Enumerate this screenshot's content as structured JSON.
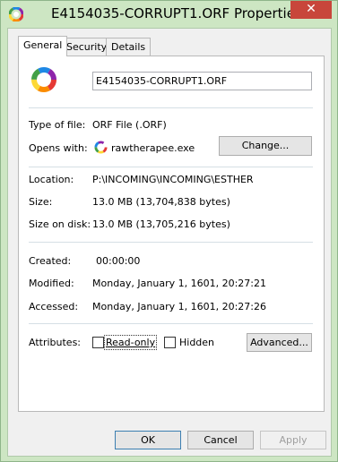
{
  "window": {
    "title": "E4154035-CORRUPT1.ORF Properties",
    "close_glyph": "✕",
    "icon": "color-wheel-icon"
  },
  "tabs": [
    {
      "label": "General",
      "active": true
    },
    {
      "label": "Security",
      "active": false
    },
    {
      "label": "Details",
      "active": false
    }
  ],
  "general": {
    "file_name": "E4154035-CORRUPT1.ORF",
    "type_label": "Type of file:",
    "type_value": "ORF File (.ORF)",
    "opens_label": "Opens with:",
    "opens_value": "rawtherapee.exe",
    "change_button": "Change...",
    "location_label": "Location:",
    "location_value": "P:\\INCOMING\\INCOMING\\ESTHER",
    "size_label": "Size:",
    "size_value": "13.0 MB (13,704,838 bytes)",
    "size_on_disk_label": "Size on disk:",
    "size_on_disk_value": "13.0 MB (13,705,216 bytes)",
    "created_label": "Created:",
    "created_value": "00:00:00",
    "modified_label": "Modified:",
    "modified_value": "Monday, January 1, 1601, 20:27:21",
    "accessed_label": "Accessed:",
    "accessed_value": "Monday, January 1, 1601, 20:27:26",
    "attributes_label": "Attributes:",
    "readonly_label": "Read-only",
    "readonly_checked": false,
    "hidden_label": "Hidden",
    "hidden_checked": false,
    "advanced_button": "Advanced..."
  },
  "footer": {
    "ok_button": "OK",
    "cancel_button": "Cancel",
    "apply_button": "Apply",
    "apply_enabled": false
  },
  "colors": {
    "frame": "#cde6c3",
    "close": "#c8463b",
    "dialog": "#f0f0f0"
  }
}
